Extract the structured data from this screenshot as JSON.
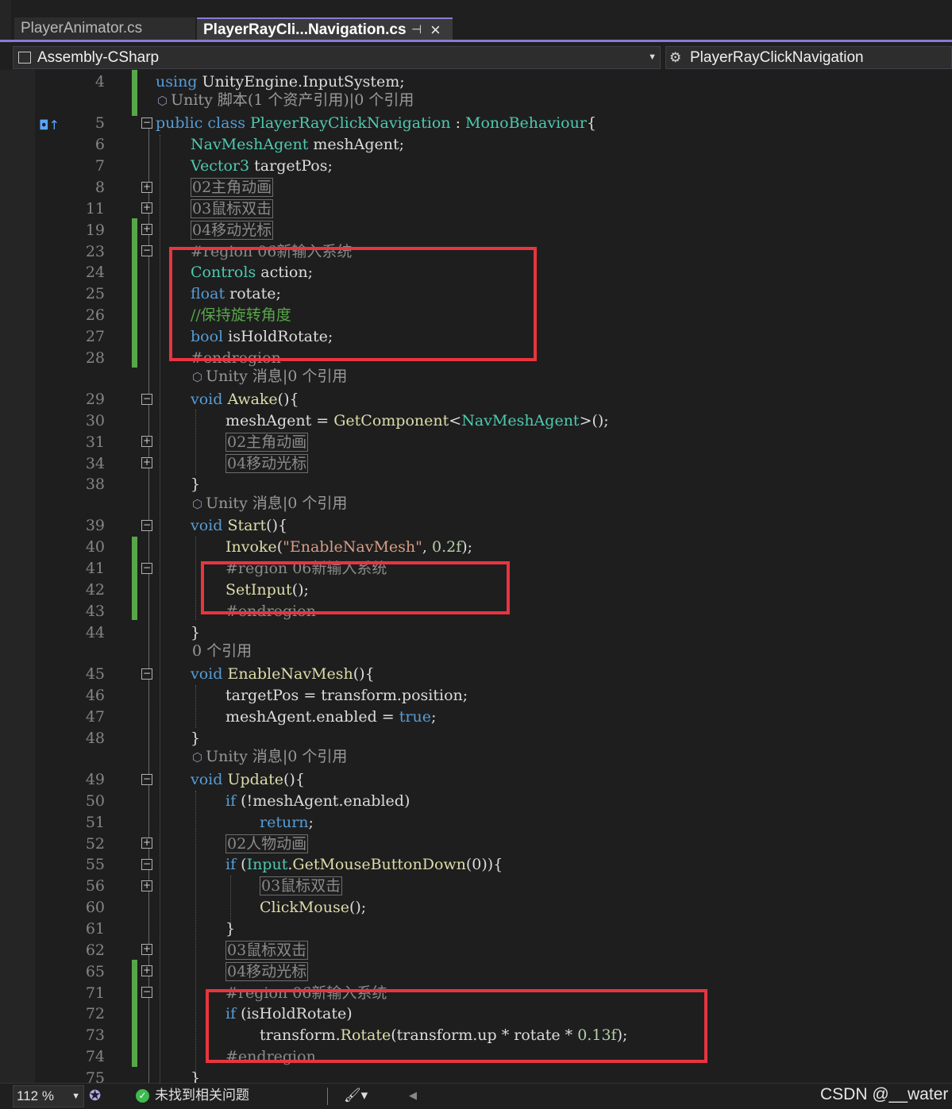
{
  "tabs": [
    {
      "label": "PlayerAnimator.cs",
      "active": false
    },
    {
      "label": "PlayerRayCli...Navigation.cs",
      "active": true
    }
  ],
  "navbar": {
    "project": "Assembly-CSharp",
    "member": "PlayerRayClickNavigation"
  },
  "lens": {
    "class_refs": "Unity 脚本(1 个资产引用)|0 个引用",
    "unity_msg": "Unity 消息|0 个引用",
    "zero_refs": "0 个引用"
  },
  "code": {
    "using": "using",
    "using_rest": " UnityEngine.InputSystem;",
    "public_class": "public class ",
    "class_name": "PlayerRayClickNavigation",
    "colon": " : ",
    "base_class": "MonoBehaviour",
    "brace_open": "{",
    "brace_close": "}",
    "navmesh_type": "NavMeshAgent",
    "mesh_agent_decl": " meshAgent;",
    "vector3_type": "Vector3",
    "target_pos_decl": " targetPos;",
    "region_02": "02主角动画",
    "region_03": "03鼠标双击",
    "region_04": "04移动光标",
    "region_02b": "02人物动画",
    "region_06": "#region 06新输入系统",
    "endregion": "#endregion",
    "controls_type": "Controls",
    "action_decl": " action;",
    "float_kw": "float",
    "rotate_decl": " rotate;",
    "comment_rotate": "//保持旋转角度",
    "bool_kw": "bool",
    "is_hold_decl": " isHoldRotate;",
    "void_kw": "void ",
    "awake": "Awake",
    "parens": "(){",
    "mesh_agent_assign": "meshAgent = ",
    "get_component": "GetComponent",
    "lt": "<",
    "gt_call": ">();",
    "start": "Start",
    "invoke": "Invoke",
    "paren_open": "(",
    "enable_str": "\"EnableNavMesh\"",
    "comma": ", ",
    "delay": "0.2f",
    "close_stmt": ");",
    "set_input": "SetInput",
    "call_end": "();",
    "enable_nav_mesh": "EnableNavMesh",
    "target_assign": "targetPos = transform.position;",
    "enabled_assign": "meshAgent.enabled = ",
    "true_kw": "true",
    "semicolon": ";",
    "update": "Update",
    "if_kw": "if",
    "not_enabled": " (!meshAgent.enabled)",
    "return_kw": "return",
    "input_type": "Input",
    "dot": ".",
    "get_mouse_down": "GetMouseButtonDown",
    "mouse_arg": "(0)){",
    "click_mouse": "ClickMouse",
    "is_hold_cond": " (isHoldRotate)",
    "transform_dot": "transform.",
    "rotate_fn": "Rotate",
    "rotate_args": "(transform.up * rotate * ",
    "rotate_factor": "0.13f",
    "rotate_end": ");"
  },
  "line_numbers": [
    "4",
    "5",
    "6",
    "7",
    "8",
    "11",
    "19",
    "23",
    "24",
    "25",
    "26",
    "27",
    "28",
    "29",
    "30",
    "31",
    "34",
    "38",
    "39",
    "40",
    "41",
    "42",
    "43",
    "44",
    "45",
    "46",
    "47",
    "48",
    "49",
    "50",
    "51",
    "52",
    "55",
    "56",
    "60",
    "61",
    "62",
    "65",
    "71",
    "72",
    "73",
    "74",
    "75"
  ],
  "statusbar": {
    "zoom": "112 %",
    "issues": "未找到相关问题"
  },
  "watermark": "CSDN @__water",
  "colors": {
    "keyword": "#569cd6",
    "type": "#4ec9b0",
    "method": "#dcdcaa",
    "string": "#d69d85",
    "number": "#b5cea8",
    "comment": "#57a64a",
    "highlight_box": "#e8353f",
    "tab_accent": "#8b79d8"
  }
}
